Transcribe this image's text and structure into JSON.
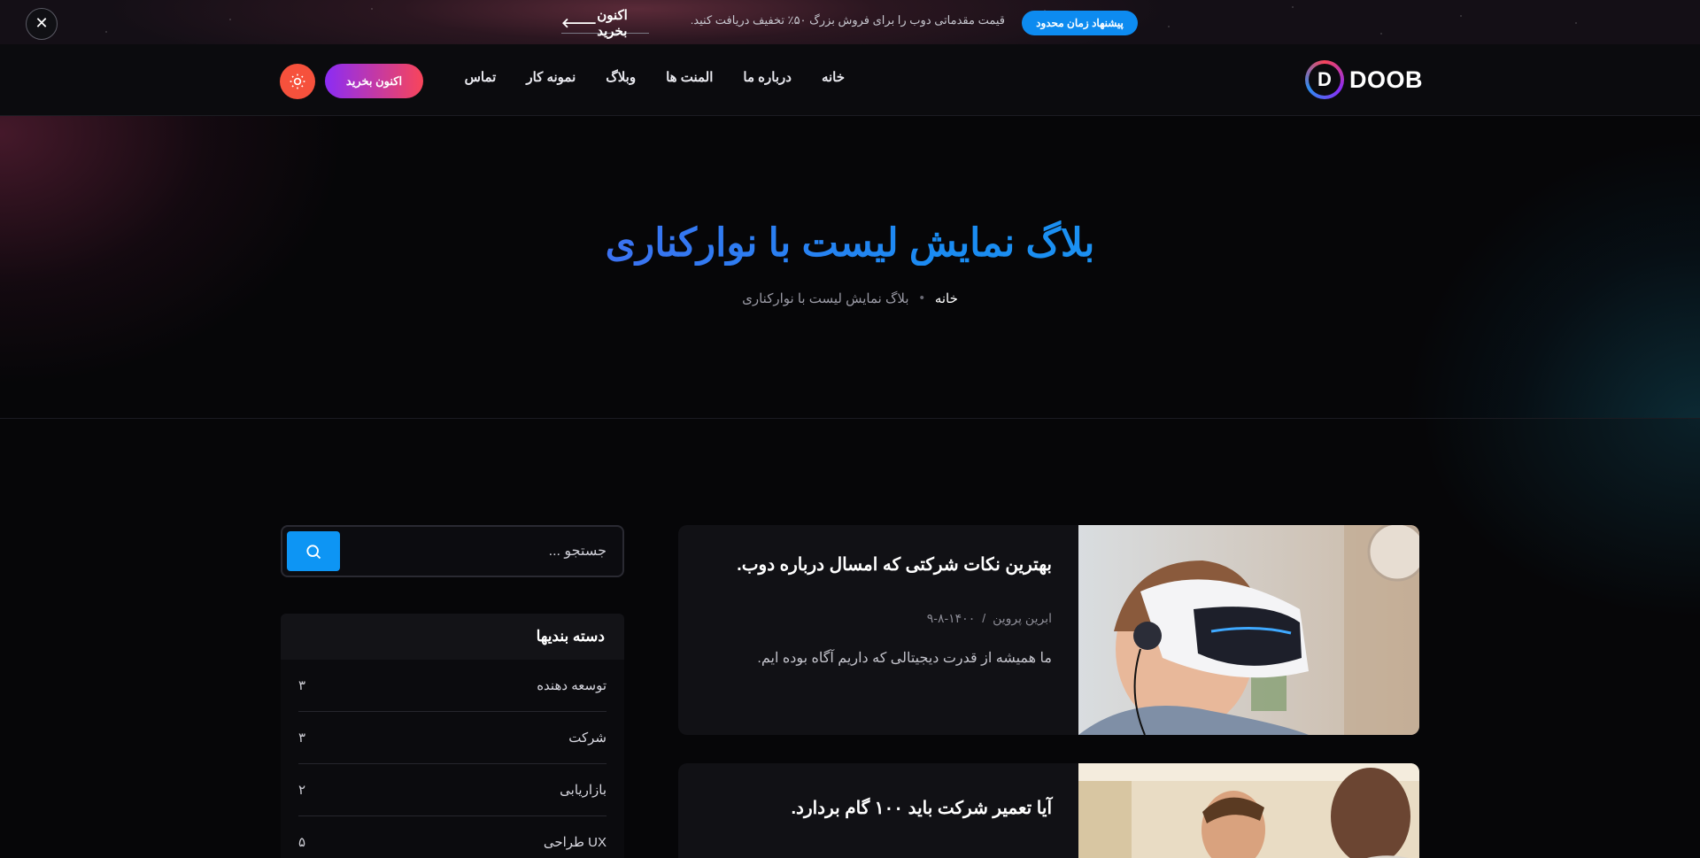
{
  "promo": {
    "badge": "پیشنهاد زمان محدود",
    "text": "قیمت مقدماتی دوب را برای فروش بزرگ ۵۰٪ تخفیف دریافت کنید.",
    "link_label": "اکنون بخرید",
    "link_icon": "arrow-left-icon",
    "close_icon": "close-icon"
  },
  "header": {
    "logo_mark": "D",
    "logo_text": "DOOB",
    "nav": [
      "خانه",
      "درباره ما",
      "المنت ها",
      "وبلاگ",
      "نمونه کار",
      "تماس"
    ],
    "buy_label": "اکنون بخرید",
    "theme_icon": "sun-icon"
  },
  "hero": {
    "title": "بلاگ نمایش لیست با نوارکناری",
    "breadcrumb": {
      "home": "خانه",
      "current": "بلاگ نمایش لیست با نوارکناری"
    }
  },
  "posts": [
    {
      "title": "بهترین نکات شرکتی که امسال درباره دوب.",
      "author": "ابرین پروین",
      "date": "۱۴۰۰-۸-۹",
      "excerpt": "ما همیشه از قدرت دیجیتالی که داریم آگاه بوده ایم.",
      "image": "vr-headset-boy-photo"
    },
    {
      "title": "آیا تعمیر شرکت باید ۱۰۰ گام بردارد.",
      "image": "two-men-meeting-photo"
    }
  ],
  "sidebar": {
    "search_placeholder": "جستجو ...",
    "search_icon": "search-icon",
    "categories_title": "دسته بندیها",
    "categories": [
      {
        "name": "توسعه دهنده",
        "count": "۳"
      },
      {
        "name": "شرکت",
        "count": "۳"
      },
      {
        "name": "بازاریابی",
        "count": "۲"
      },
      {
        "name": "UX طراحی",
        "count": "۵"
      }
    ]
  },
  "colors": {
    "accent_blue": "#0d95f4",
    "gradient_start": "#8b2cf5",
    "gradient_end": "#f8455a",
    "theme_button": "#f6513c"
  }
}
